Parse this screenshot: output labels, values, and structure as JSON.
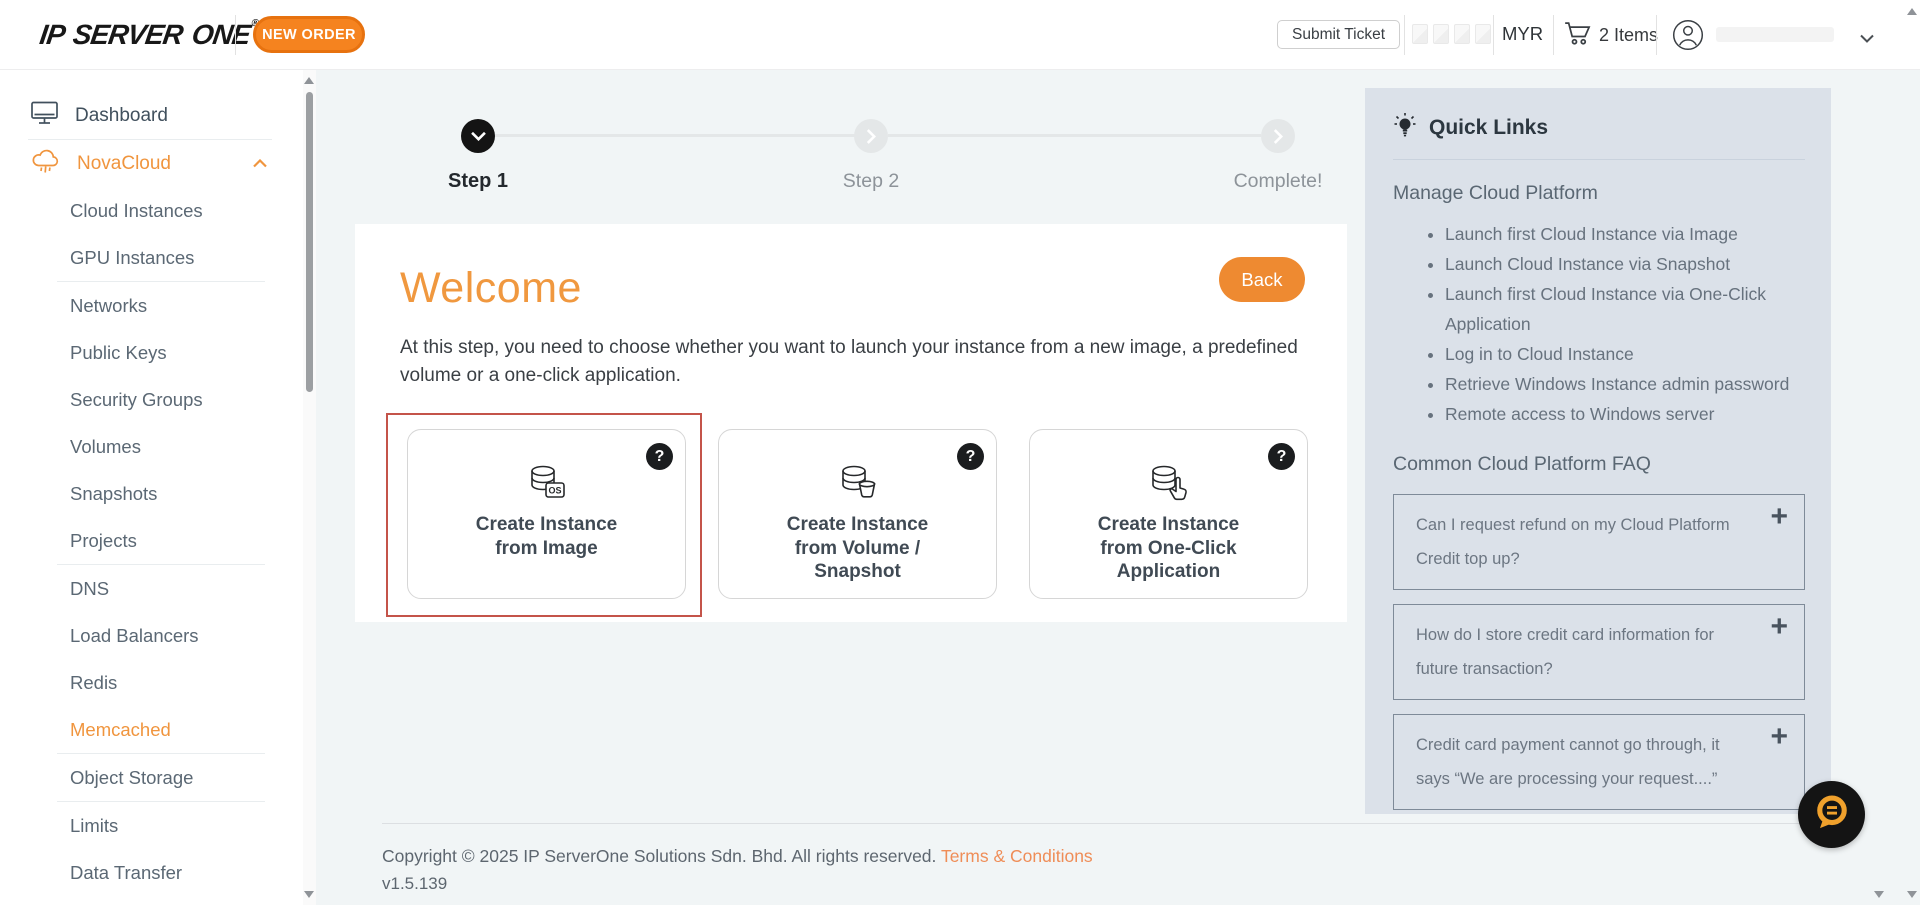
{
  "header": {
    "logo_text": "IP SERVER ONE",
    "new_order_label": "NEW ORDER",
    "submit_ticket_label": "Submit Ticket",
    "currency": "MYR",
    "cart_label": "2 Items"
  },
  "glyphs": {
    "registered": "®",
    "help": "?",
    "expand": "+"
  },
  "colors": {
    "accent_orange": "#f5831f",
    "heading_orange": "#f0983f",
    "selected_card_border": "#c4544a",
    "quick_links_bg": "#dbe1e9",
    "main_bg": "#f1f5f6"
  },
  "sidebar": {
    "items": [
      {
        "label": "Dashboard"
      },
      {
        "label": "NovaCloud"
      },
      {
        "label": "Cloud Instances"
      },
      {
        "label": "GPU Instances"
      },
      {
        "label": "Networks"
      },
      {
        "label": "Public Keys"
      },
      {
        "label": "Security Groups"
      },
      {
        "label": "Volumes"
      },
      {
        "label": "Snapshots"
      },
      {
        "label": "Projects"
      },
      {
        "label": "DNS"
      },
      {
        "label": "Load Balancers"
      },
      {
        "label": "Redis"
      },
      {
        "label": "Memcached"
      },
      {
        "label": "Object Storage"
      },
      {
        "label": "Limits"
      },
      {
        "label": "Data Transfer"
      }
    ],
    "active_item": "Memcached"
  },
  "stepper": {
    "steps": [
      {
        "label": "Step 1",
        "state": "active"
      },
      {
        "label": "Step 2",
        "state": "upcoming"
      },
      {
        "label": "Complete!",
        "state": "upcoming"
      }
    ]
  },
  "welcome": {
    "title": "Welcome",
    "back_label": "Back",
    "description": "At this step, you need to choose whether you want to launch your instance from a new image, a predefined volume or a one-click application."
  },
  "cards": [
    {
      "label": "Create Instance from Image",
      "selected": true
    },
    {
      "label": "Create Instance from Volume / Snapshot",
      "selected": false
    },
    {
      "label": "Create Instance from One-Click Application",
      "selected": false
    }
  ],
  "quick_links": {
    "title": "Quick Links",
    "section1_title": "Manage Cloud Platform",
    "links": [
      "Launch first Cloud Instance via Image",
      "Launch Cloud Instance via Snapshot",
      "Launch first Cloud Instance via One-Click Application",
      "Log in to Cloud Instance",
      "Retrieve Windows Instance admin password",
      "Remote access to Windows server"
    ],
    "section2_title": "Common Cloud Platform FAQ",
    "faqs": [
      {
        "question": "Can I request refund on my Cloud Platform Credit top up?"
      },
      {
        "question": "How do I store credit card information for future transaction?"
      },
      {
        "question": "Credit card payment cannot go through, it says “We are processing your request....”"
      }
    ]
  },
  "footer": {
    "copyright": "Copyright © 2025 IP ServerOne Solutions Sdn. Bhd. All rights reserved. ",
    "terms_label": "Terms & Conditions",
    "version": "v1.5.139"
  }
}
